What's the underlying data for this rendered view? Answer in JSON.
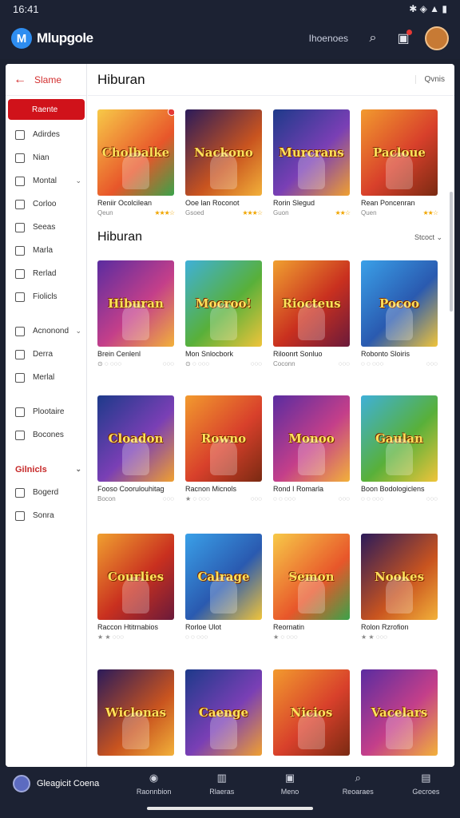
{
  "status": {
    "time": "16:41",
    "icons": "✱ ◈ ▲ ▮"
  },
  "app": {
    "name": "Mlupgole",
    "logo_letter": "M",
    "header_link": "Ihoenoes"
  },
  "sidebar": {
    "back_label": "Slame",
    "items": [
      {
        "label": "Raente",
        "active": true
      },
      {
        "label": "Adirdes"
      },
      {
        "label": "Nian"
      },
      {
        "label": "Montal",
        "chev": "⌄"
      },
      {
        "label": "Corloo"
      },
      {
        "label": "Seeas"
      },
      {
        "label": "Marla"
      },
      {
        "label": "Rerlad"
      },
      {
        "label": "Fiolicls"
      },
      {
        "label": "Acnonond",
        "chev": "⌄"
      },
      {
        "label": "Derra"
      },
      {
        "label": "Merlal"
      },
      {
        "label": "Plootaire"
      },
      {
        "label": "Bocones"
      },
      {
        "label": "Gilnicls",
        "chev": "⌄",
        "section": true
      },
      {
        "label": "Bogerd"
      },
      {
        "label": "Sonra"
      }
    ]
  },
  "main": {
    "title": "Hiburan",
    "header_button": "Qvnis",
    "section2_title": "Hiburan",
    "section2_sort": "Stcoct ⌄",
    "row1": [
      {
        "title": "Cholbalke",
        "name": "Reniir Ocolcilean",
        "meta": "Qeun",
        "stars": "★★★☆",
        "badge": true
      },
      {
        "title": "Nackono",
        "name": "Ooe lan Roconot",
        "meta": "Gsoed",
        "stars": "★★★☆"
      },
      {
        "title": "Murcrans",
        "name": "Rorin Slegud",
        "meta": "Guon",
        "stars": "★★☆"
      },
      {
        "title": "Pacloue",
        "name": "Rean Poncenran",
        "meta": "Quen",
        "stars": "★★☆"
      }
    ],
    "row2": [
      {
        "title": "Hiburan",
        "name": "Brein Cenlenl",
        "meta": "⊙ ◌ ◌◌◌",
        "right": "◌◌◌"
      },
      {
        "title": "Mocroo!",
        "name": "Mon Snlocbork",
        "meta": "⊙ ◌ ◌◌◌",
        "right": "◌◌◌"
      },
      {
        "title": "Riocteus",
        "name": "Riloonrt Sonluo",
        "meta": "Coconn",
        "right": "◌◌◌"
      },
      {
        "title": "Pocoo",
        "name": "Robonto Sloiris",
        "meta": "◌ ◌ ◌◌◌",
        "right": "◌◌◌"
      }
    ],
    "row3": [
      {
        "title": "Cloadon",
        "name": "Fooso Coorulouhitag",
        "meta": "Bocon",
        "right": "◌◌◌"
      },
      {
        "title": "Rowno",
        "name": "Racnon Micnols",
        "meta": "★ ◌ ◌◌◌",
        "right": "◌◌◌"
      },
      {
        "title": "Monoo",
        "name": "Rond I Romarla",
        "meta": "◌ ◌ ◌◌◌",
        "right": "◌◌◌"
      },
      {
        "title": "Gaulan",
        "name": "Boon Bodologiclens",
        "meta": "◌ ◌ ◌◌◌",
        "right": "◌◌◌"
      }
    ],
    "row4": [
      {
        "title": "Courlies",
        "name": "Raccon Htitrnabios",
        "meta": "★ ★ ◌◌◌",
        "right": ""
      },
      {
        "title": "Calrage",
        "name": "Rorloe Ulot",
        "meta": "◌ ◌ ◌◌◌",
        "right": ""
      },
      {
        "title": "Semon",
        "name": "Reornatin",
        "meta": "★ ◌ ◌◌◌",
        "right": ""
      },
      {
        "title": "Nookes",
        "name": "Rolon Rzrofion",
        "meta": "★ ★ ◌◌◌",
        "right": ""
      }
    ],
    "row5": [
      {
        "title": "Wiclonas",
        "name": "",
        "meta": "",
        "right": ""
      },
      {
        "title": "Caenge",
        "name": "",
        "meta": "",
        "right": ""
      },
      {
        "title": "Nicios",
        "name": "",
        "meta": "",
        "right": ""
      },
      {
        "title": "Vacelars",
        "name": "",
        "meta": "",
        "right": ""
      }
    ]
  },
  "bottom": {
    "profile": "Gleagicit Coena",
    "tabs": [
      {
        "icon": "◉",
        "label": "Raonnbion"
      },
      {
        "icon": "▥",
        "label": "Rlaeras"
      },
      {
        "icon": "▣",
        "label": "Meno"
      },
      {
        "icon": "⌕",
        "label": "Reoaraes"
      },
      {
        "icon": "▤",
        "label": "Gecroes"
      }
    ]
  }
}
